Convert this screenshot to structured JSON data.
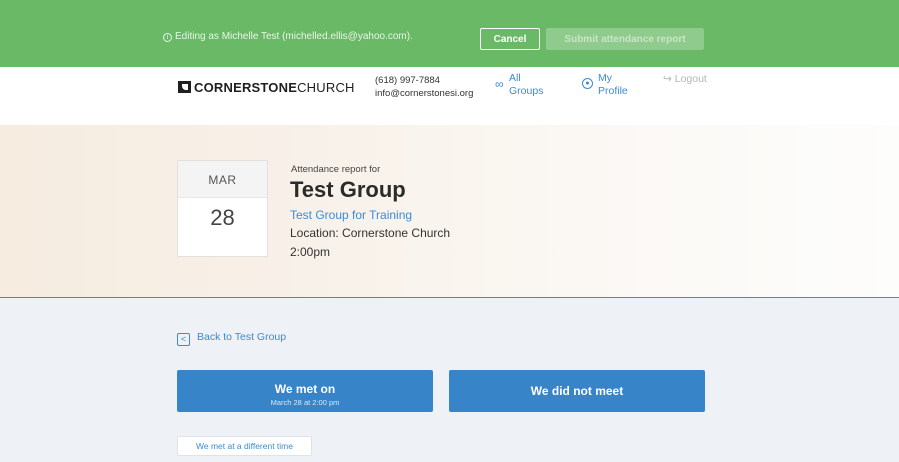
{
  "banner": {
    "editing_text": "Editing as Michelle Test (michelled.ellis@yahoo.com).",
    "cancel_label": "Cancel",
    "submit_label": "Submit attendance report",
    "color": "#69b966"
  },
  "header": {
    "logo_bold": "CORNERSTONE",
    "logo_light": "CHURCH",
    "phone": "(618) 997-7884",
    "email": "info@cornerstonesi.org",
    "nav": {
      "all_line1": "All",
      "all_line2": "Groups",
      "profile_line1": "My",
      "profile_line2": "Profile",
      "logout": "Logout"
    }
  },
  "event": {
    "month": "MAR",
    "day": "28",
    "report_for": "Attendance report for",
    "group_name": "Test Group",
    "group_link": "Test Group for Training",
    "location": "Location: Cornerstone Church",
    "time": "2:00pm"
  },
  "actions": {
    "back_label": "Back to Test Group",
    "met_label": "We met on",
    "met_sub": "March 28 at 2:00 pm",
    "not_met_label": "We did not meet",
    "different_time_label": "We met at a different time",
    "accent": "#3884c8"
  }
}
